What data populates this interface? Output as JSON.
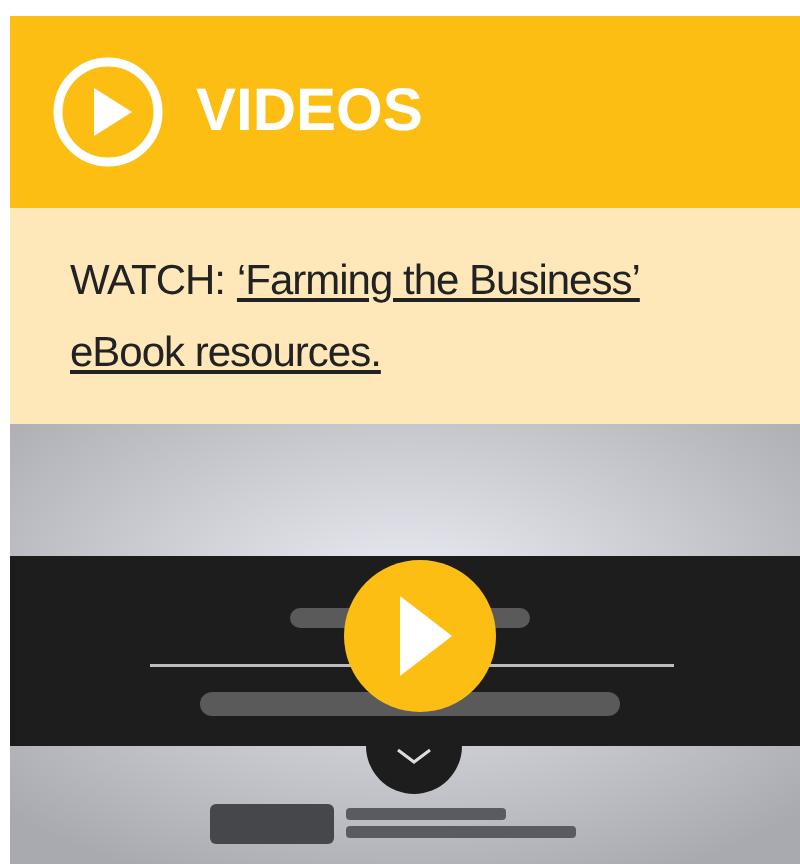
{
  "header": {
    "title": "VIDEOS"
  },
  "intro": {
    "lead": "WATCH:",
    "link_lines": [
      "‘Farming the Business’",
      "eBook resources."
    ]
  }
}
